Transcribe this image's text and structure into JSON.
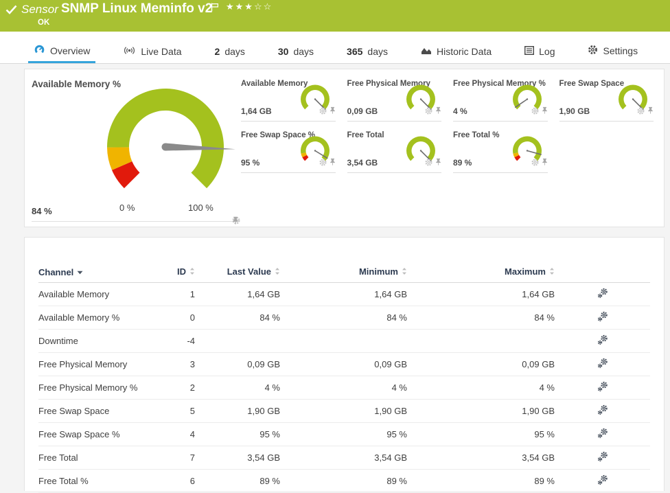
{
  "header": {
    "kind_label": "Sensor",
    "title": "SNMP Linux Meminfo v2",
    "status_text": "OK",
    "stars": "★★★☆☆",
    "rating": {
      "filled": 3,
      "total": 5
    }
  },
  "tabs": [
    {
      "label": "Overview",
      "active": true
    },
    {
      "label": "Live Data"
    },
    {
      "prefix": "2",
      "suffix": "days"
    },
    {
      "prefix": "30",
      "suffix": "days"
    },
    {
      "prefix": "365",
      "suffix": "days"
    },
    {
      "label": "Historic Data"
    },
    {
      "label": "Log"
    },
    {
      "label": "Settings"
    }
  ],
  "gauges": {
    "main": {
      "title": "Available Memory %",
      "value_label": "84 %",
      "value_percent": 84,
      "min_label": "0 %",
      "max_label": "100 %",
      "segments": [
        {
          "from": 0,
          "to": 8,
          "color": "#e11a0c"
        },
        {
          "from": 8,
          "to": 16.5,
          "color": "#f0b400"
        },
        {
          "from": 16.5,
          "to": 100,
          "color": "#a4c11e"
        }
      ]
    },
    "minis": [
      {
        "title": "Available Memory",
        "value_label": "1,64 GB",
        "value_percent": 100,
        "segments": [
          {
            "from": 0,
            "to": 100,
            "color": "#a4c11e"
          }
        ]
      },
      {
        "title": "Free Physical Memory",
        "value_label": "0,09 GB",
        "value_percent": 100,
        "segments": [
          {
            "from": 0,
            "to": 100,
            "color": "#a4c11e"
          }
        ]
      },
      {
        "title": "Free Physical Memory %",
        "value_label": "4 %",
        "value_percent": 4,
        "segments": [
          {
            "from": 0,
            "to": 100,
            "color": "#a4c11e"
          }
        ]
      },
      {
        "title": "Free Swap Space",
        "value_label": "1,90 GB",
        "value_percent": 100,
        "segments": [
          {
            "from": 0,
            "to": 100,
            "color": "#a4c11e"
          }
        ]
      },
      {
        "title": "Free Swap Space %",
        "value_label": "95 %",
        "value_percent": 95,
        "segments": [
          {
            "from": 0,
            "to": 6.5,
            "color": "#e11a0c"
          },
          {
            "from": 6.5,
            "to": 12.5,
            "color": "#f0b400"
          },
          {
            "from": 12.5,
            "to": 100,
            "color": "#a4c11e"
          }
        ]
      },
      {
        "title": "Free Total",
        "value_label": "3,54 GB",
        "value_percent": 100,
        "segments": [
          {
            "from": 0,
            "to": 100,
            "color": "#a4c11e"
          }
        ]
      },
      {
        "title": "Free Total %",
        "value_label": "89 %",
        "value_percent": 89,
        "segments": [
          {
            "from": 0,
            "to": 6.5,
            "color": "#e11a0c"
          },
          {
            "from": 6.5,
            "to": 12.5,
            "color": "#f0b400"
          },
          {
            "from": 12.5,
            "to": 100,
            "color": "#a4c11e"
          }
        ]
      }
    ]
  },
  "table": {
    "columns": {
      "channel": "Channel",
      "id": "ID",
      "last": "Last Value",
      "min": "Minimum",
      "max": "Maximum"
    },
    "sorted_by": "Channel",
    "rows": [
      {
        "channel": "Available Memory",
        "id": "1",
        "last": "1,64 GB",
        "min": "1,64 GB",
        "max": "1,64 GB"
      },
      {
        "channel": "Available Memory %",
        "id": "0",
        "last": "84 %",
        "min": "84 %",
        "max": "84 %"
      },
      {
        "channel": "Downtime",
        "id": "-4",
        "last": "",
        "min": "",
        "max": ""
      },
      {
        "channel": "Free Physical Memory",
        "id": "3",
        "last": "0,09 GB",
        "min": "0,09 GB",
        "max": "0,09 GB"
      },
      {
        "channel": "Free Physical Memory %",
        "id": "2",
        "last": "4 %",
        "min": "4 %",
        "max": "4 %"
      },
      {
        "channel": "Free Swap Space",
        "id": "5",
        "last": "1,90 GB",
        "min": "1,90 GB",
        "max": "1,90 GB"
      },
      {
        "channel": "Free Swap Space %",
        "id": "4",
        "last": "95 %",
        "min": "95 %",
        "max": "95 %"
      },
      {
        "channel": "Free Total",
        "id": "7",
        "last": "3,54 GB",
        "min": "3,54 GB",
        "max": "3,54 GB"
      },
      {
        "channel": "Free Total %",
        "id": "6",
        "last": "89 %",
        "min": "89 %",
        "max": "89 %"
      }
    ]
  },
  "colors": {
    "header_green": "#a8c133",
    "gauge_green": "#a4c11e",
    "gauge_yellow": "#f0b400",
    "gauge_red": "#e11a0c",
    "accent_blue": "#35a4db",
    "table_header_text": "#2c3a50"
  }
}
